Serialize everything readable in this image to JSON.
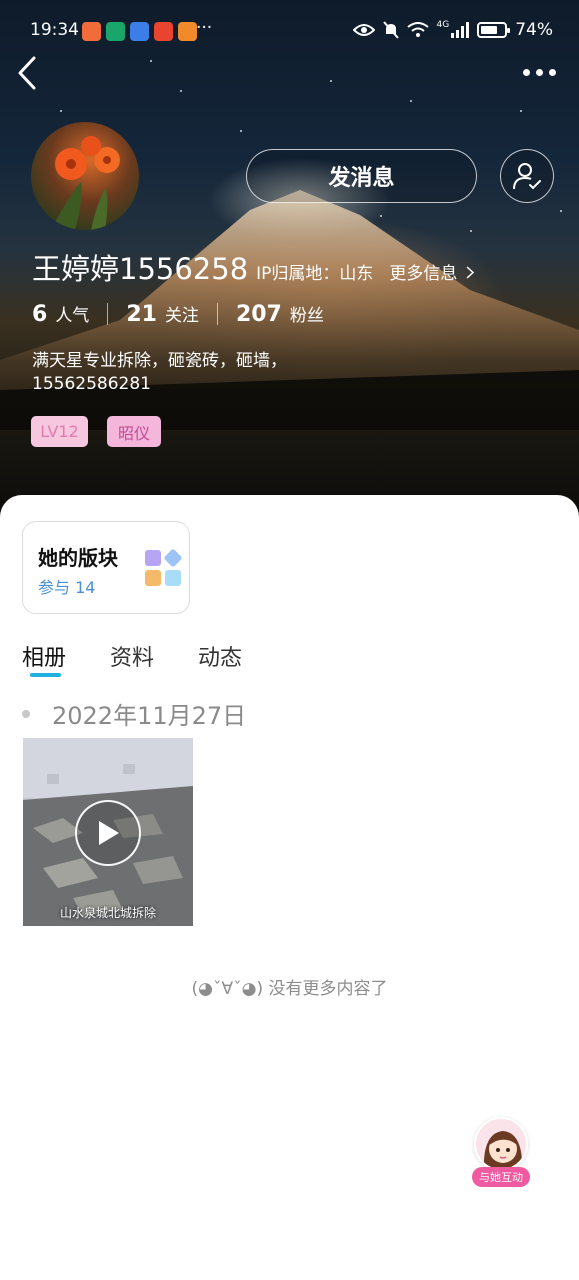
{
  "status_bar": {
    "time": "19:34",
    "more_indicator": "···",
    "network_label": "4G",
    "battery_text": "74%",
    "battery_level": 0.74,
    "app_colors": [
      "#f26b3a",
      "#1aa56b",
      "#3b7ee8",
      "#e8442f",
      "#f08a2a"
    ]
  },
  "nav": {
    "back_icon": "chevron-left-icon",
    "more_icon": "more-dots-icon"
  },
  "profile": {
    "name": "王婷婷1556258",
    "ip_location": "IP归属地：山东",
    "more_info": "更多信息",
    "stats": [
      {
        "value": "6",
        "label": "人气"
      },
      {
        "value": "21",
        "label": "关注"
      },
      {
        "value": "207",
        "label": "粉丝"
      }
    ],
    "bio_line1": "满天星专业拆除，砸瓷砖，砸墙，",
    "bio_line2": "15562586281",
    "tags": {
      "level": "LV12",
      "title": "昭仪"
    }
  },
  "actions": {
    "message_button": "发消息",
    "follow_icon": "user-check-icon"
  },
  "board": {
    "title": "她的版块",
    "count_text": "参与 14"
  },
  "tabs": [
    {
      "label": "相册",
      "active": true
    },
    {
      "label": "资料",
      "active": false
    },
    {
      "label": "动态",
      "active": false
    }
  ],
  "album": {
    "date": "2022年11月27日",
    "video_caption": "山水泉城北城拆除"
  },
  "footer": {
    "end_text": "(◕ˇ∀ˇ◕) 没有更多内容了",
    "interact_label": "与她互动"
  },
  "colors": {
    "accent_blue": "#1fb0e0",
    "link_blue": "#4a8fd6",
    "tag_pink": "#f7c7e0",
    "interact_pink": "#f05aa0"
  }
}
